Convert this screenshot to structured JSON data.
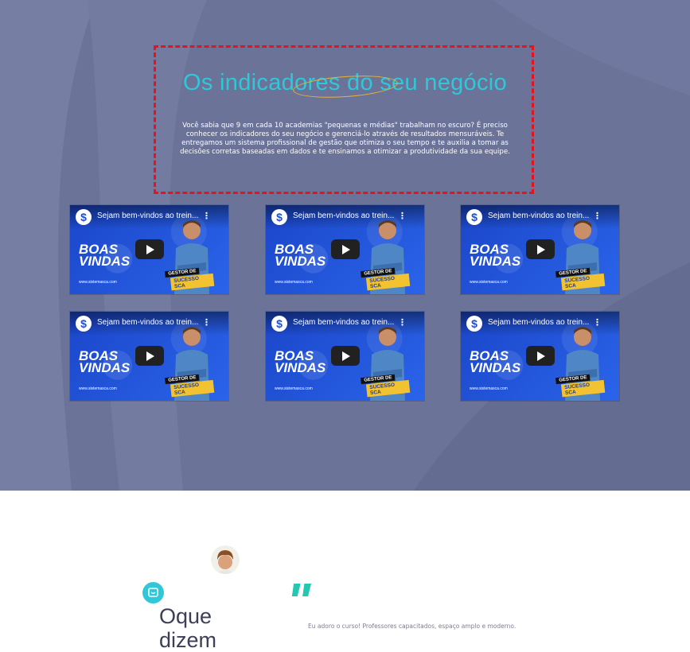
{
  "hero": {
    "title": "Os indicadores do seu negócio",
    "description": "Você sabia que 9 em cada 10 academias \"pequenas e médias\" trabalham no escuro? É preciso conhecer os indicadores do seu negócio e gerenciá-lo através de resultados mensuráveis. Te entregamos um sistema profissional de gestão que otimiza o seu tempo e te auxilia a tomar as decisões corretas baseadas em dados e te ensinamos a otimizar a produtividade da sua equipe.",
    "colors": {
      "background": "#6b7398",
      "title": "#2fc8d8",
      "highlight_box": "#e8121b",
      "circle_mark": "#e3b53a"
    }
  },
  "videos": [
    {
      "title": "Sejam bem-vindos ao trein...",
      "headline": [
        "BOAS",
        "VINDAS"
      ],
      "badge_top": "GESTOR DE",
      "badge_bottom": "SUCESSO SCA",
      "site": "www.sistemasca.com"
    },
    {
      "title": "Sejam bem-vindos ao trein...",
      "headline": [
        "BOAS",
        "VINDAS"
      ],
      "badge_top": "GESTOR DE",
      "badge_bottom": "SUCESSO SCA",
      "site": "www.sistemasca.com"
    },
    {
      "title": "Sejam bem-vindos ao trein...",
      "headline": [
        "BOAS",
        "VINDAS"
      ],
      "badge_top": "GESTOR DE",
      "badge_bottom": "SUCESSO SCA",
      "site": "www.sistemasca.com"
    },
    {
      "title": "Sejam bem-vindos ao trein...",
      "headline": [
        "BOAS",
        "VINDAS"
      ],
      "badge_top": "GESTOR DE",
      "badge_bottom": "SUCESSO SCA",
      "site": "www.sistemasca.com"
    },
    {
      "title": "Sejam bem-vindos ao trein...",
      "headline": [
        "BOAS",
        "VINDAS"
      ],
      "badge_top": "GESTOR DE",
      "badge_bottom": "SUCESSO SCA",
      "site": "www.sistemasca.com"
    },
    {
      "title": "Sejam bem-vindos ao trein...",
      "headline": [
        "BOAS",
        "VINDAS"
      ],
      "badge_top": "GESTOR DE",
      "badge_bottom": "SUCESSO SCA",
      "site": "www.sistemasca.com"
    }
  ],
  "channel_icon": "dollar-s-logo",
  "testimonials": {
    "section_title_line1": "Oque",
    "section_title_line2": "dizem",
    "quote_mark": "\"",
    "text": "Eu adoro o curso! Professores capacitados, espaço amplo e moderno.",
    "icons": {
      "avatar": "user-avatar",
      "chat": "chat-bubble-icon"
    }
  }
}
